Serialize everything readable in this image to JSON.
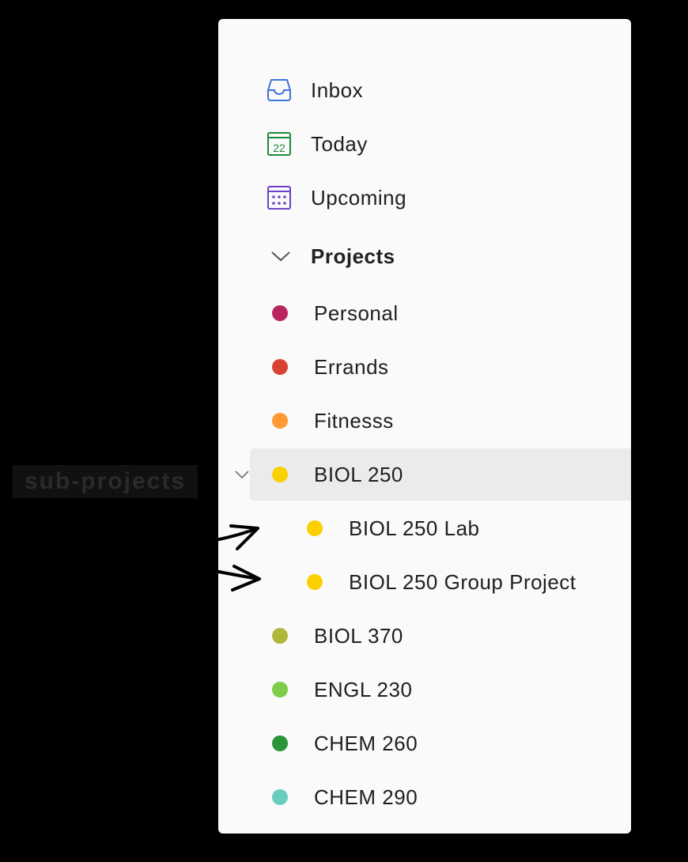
{
  "nav": {
    "items": [
      {
        "label": "Inbox",
        "icon": "inbox-icon",
        "color": "#3b73d8"
      },
      {
        "label": "Today",
        "icon": "calendar-today-icon",
        "day": "22",
        "color": "#1f8a3b"
      },
      {
        "label": "Upcoming",
        "icon": "calendar-upcoming-icon",
        "color": "#6b43c8"
      }
    ]
  },
  "projects": {
    "title": "Projects",
    "items": [
      {
        "label": "Personal",
        "color": "#b8255f"
      },
      {
        "label": "Errands",
        "color": "#db4035"
      },
      {
        "label": "Fitnesss",
        "color": "#ff9933"
      },
      {
        "label": "BIOL 250",
        "color": "#fad000",
        "selected": true,
        "expanded": true
      },
      {
        "label": "BIOL 250 Lab",
        "color": "#fad000",
        "child": true
      },
      {
        "label": "BIOL 250 Group Project",
        "color": "#fad000",
        "child": true
      },
      {
        "label": "BIOL 370",
        "color": "#afb83b"
      },
      {
        "label": "ENGL 230",
        "color": "#7ecc49"
      },
      {
        "label": "CHEM 260",
        "color": "#299438"
      },
      {
        "label": "CHEM 290",
        "color": "#6accbc"
      }
    ]
  },
  "annotation": {
    "label": "sub-projects"
  }
}
